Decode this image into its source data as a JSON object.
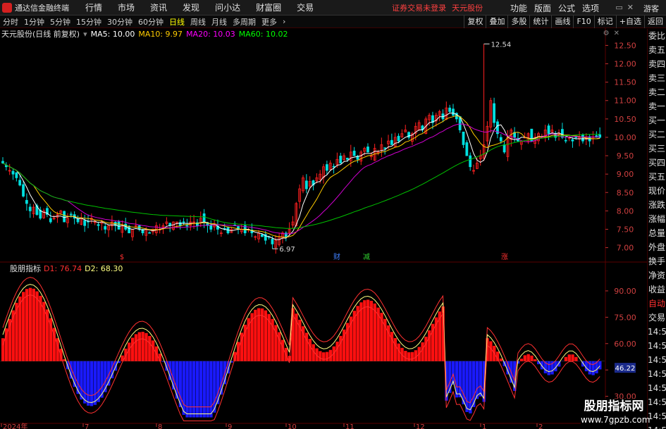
{
  "titlebar": {
    "app_title": "通达信金融终端",
    "menus": [
      "行情",
      "市场",
      "资讯",
      "发现",
      "问小达",
      "财富圈",
      "交易"
    ],
    "notice": "证券交易未登录",
    "stock_name": "天元股份",
    "right_menus": [
      "功能",
      "版面",
      "公式",
      "选项"
    ],
    "guest": "游客"
  },
  "toolbar": {
    "periods": [
      "分时",
      "1分钟",
      "5分钟",
      "15分钟",
      "30分钟",
      "60分钟",
      "日线",
      "周线",
      "月线",
      "多周期",
      "更多"
    ],
    "active_period": "日线",
    "right": [
      "复权",
      "叠加",
      "多股",
      "统计",
      "画线",
      "F10",
      "标记",
      "+自选",
      "返回"
    ]
  },
  "chart_head": {
    "stock": "天元股份(日线 前复权)",
    "ma5": "MA5: 10.00",
    "ma10": "MA10: 9.97",
    "ma20": "MA20: 10.03",
    "ma60": "MA60: 10.02"
  },
  "indicator_head": {
    "name": "股朋指标",
    "d1": "D1: 76.74",
    "d2": "D2: 68.30",
    "current": "46.22"
  },
  "sidepanel": [
    "委比",
    "卖五",
    "卖四",
    "卖三",
    "卖二",
    "卖一",
    "买一",
    "买二",
    "买三",
    "买四",
    "买五",
    "现价",
    "涨跌",
    "涨幅",
    "总量",
    "外盘",
    "换手",
    "净资",
    "收益",
    "自动",
    "交易",
    "14:56",
    "14:56",
    "14:56",
    "14:56",
    "14:56",
    "14:56",
    "14:56",
    "14:56"
  ],
  "markers": {
    "high": "12.54",
    "low": "6.97",
    "s1": "$",
    "s2": "财",
    "s3": "减",
    "s4": "涨"
  },
  "x_labels": [
    "2024年",
    "7",
    "8",
    "9",
    "10",
    "11",
    "12",
    "1",
    "2"
  ],
  "watermark": {
    "line1": "股朋指标网",
    "line2": "www.7gpzb.com"
  },
  "colors": {
    "up": "#ff2020",
    "down": "#00e0e0",
    "ma60": "#00c000",
    "ma20": "#d000d0",
    "ma10": "#ffcc00",
    "ma5": "#ffffff",
    "bar_pos": "#ff1010",
    "bar_neg": "#1a1aff"
  },
  "chart_data": [
    {
      "type": "candlestick",
      "y_ticks": [
        7.0,
        7.5,
        8.0,
        8.5,
        9.0,
        9.5,
        10.0,
        10.5,
        11.0,
        11.5,
        12.0,
        12.5
      ],
      "ylim": [
        6.8,
        12.7
      ],
      "close": [
        9.3,
        9.2,
        9.1,
        9.0,
        8.9,
        8.7,
        8.4,
        8.2,
        8.0,
        8.1,
        7.9,
        7.8,
        8.0,
        7.9,
        7.7,
        7.8,
        7.9,
        8.0,
        7.7,
        7.8,
        7.9,
        7.8,
        7.7,
        7.8,
        7.6,
        7.7,
        7.8,
        7.7,
        7.6,
        7.7,
        7.5,
        7.6,
        7.7,
        7.6,
        7.5,
        7.6,
        7.5,
        7.4,
        7.5,
        7.6,
        7.5,
        7.4,
        7.5,
        7.4,
        7.5,
        7.6,
        7.5,
        7.6,
        7.7,
        7.6,
        7.7,
        7.7,
        7.6,
        7.7,
        7.6,
        7.7,
        7.7,
        7.6,
        7.8,
        7.7,
        7.6,
        7.5,
        7.6,
        7.5,
        7.4,
        7.5,
        7.4,
        7.5,
        7.6,
        7.5,
        7.5,
        7.4,
        7.5,
        7.4,
        7.3,
        7.4,
        7.3,
        7.2,
        7.3,
        7.1,
        7.2,
        7.3,
        7.4,
        7.3,
        7.5,
        7.7,
        8.2,
        8.6,
        8.9,
        8.6,
        8.8,
        8.7,
        8.9,
        9.0,
        9.2,
        9.1,
        9.3,
        9.2,
        9.4,
        9.3,
        9.5,
        9.4,
        9.6,
        9.5,
        9.4,
        9.6,
        9.7,
        9.6,
        9.5,
        9.7,
        9.6,
        9.8,
        9.7,
        9.9,
        9.8,
        10.0,
        9.9,
        10.1,
        10.2,
        10.0,
        10.1,
        10.3,
        10.4,
        10.2,
        10.5,
        10.6,
        10.4,
        10.6,
        10.7,
        10.5,
        10.8,
        10.7,
        10.6,
        10.5,
        10.2,
        9.8,
        9.5,
        9.2,
        9.1,
        9.3,
        9.5,
        9.8,
        10.3,
        11.0,
        10.4,
        10.1,
        9.9,
        9.6,
        10.0,
        10.2,
        10.0,
        9.9,
        9.9,
        10.0,
        10.1,
        9.9,
        10.0,
        10.1,
        10.0,
        10.2,
        10.1,
        10.2,
        10.0,
        10.1,
        10.0,
        9.9,
        10.0,
        9.9,
        10.0,
        10.0,
        9.9,
        10.0,
        9.9,
        10.0,
        10.0,
        10.0
      ],
      "ma_series": [
        "MA5",
        "MA10",
        "MA20",
        "MA60"
      ],
      "annotated_high": 12.54,
      "annotated_low": 6.97
    },
    {
      "type": "bar",
      "name": "股朋指标",
      "y_ticks": [
        30.0,
        45.0,
        60.0,
        75.0,
        90.0
      ],
      "ylim": [
        15,
        100
      ],
      "baseline": 50,
      "d1_last": 76.74,
      "d2_last": 68.3
    }
  ]
}
